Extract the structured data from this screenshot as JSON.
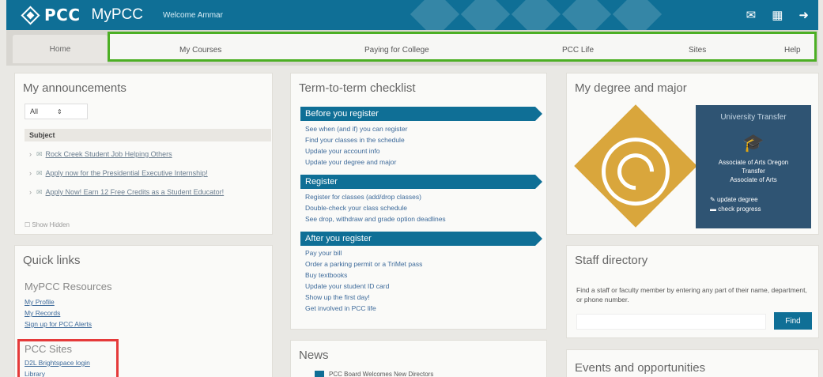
{
  "header": {
    "logo_text": "PCC",
    "app_name": "MyPCC",
    "welcome": "Welcome Ammar",
    "icons": [
      "mail-icon",
      "calendar-icon",
      "logout-icon"
    ]
  },
  "nav": {
    "home": "Home",
    "tabs": [
      "My Courses",
      "Paying for College",
      "PCC Life",
      "Sites",
      "Help"
    ]
  },
  "announcements": {
    "title": "My announcements",
    "filter_value": "All",
    "subject_header": "Subject",
    "items": [
      "Rock Creek Student Job Helping Others",
      "Apply now for the Presidential Executive Internship!",
      "Apply Now! Earn 12 Free Credits as a Student Educator!"
    ],
    "show_hidden": "Show Hidden"
  },
  "quick_links": {
    "title": "Quick links",
    "resources_title": "MyPCC Resources",
    "resources": [
      "My Profile",
      "My Records",
      "Sign up for PCC Alerts"
    ],
    "sites_title": "PCC Sites",
    "sites": [
      "D2L Brightspace login",
      "Library"
    ]
  },
  "checklist": {
    "title": "Term-to-term checklist",
    "sections": [
      {
        "heading": "Before you register",
        "items": [
          "See when (and if) you can register",
          "Find your classes in the schedule",
          "Update your account info",
          "Update your degree and major"
        ]
      },
      {
        "heading": "Register",
        "items": [
          "Register for classes (add/drop classes)",
          "Double-check your class schedule",
          "See drop, withdraw and grade option deadlines"
        ]
      },
      {
        "heading": "After you register",
        "items": [
          "Pay your bill",
          "Order a parking permit or a TriMet pass",
          "Buy textbooks",
          "Update your student ID card",
          "Show up the first day!",
          "Get involved in PCC life"
        ]
      }
    ]
  },
  "news": {
    "title": "News",
    "first_item": "PCC Board Welcomes New Directors"
  },
  "degree": {
    "title": "My degree and major",
    "card_title": "University Transfer",
    "degree_line1": "Associate of Arts Oregon",
    "degree_line2": "Transfer",
    "degree_line3": "Associate of Arts",
    "update_link": "update degree",
    "progress_link": "check progress"
  },
  "staff": {
    "title": "Staff directory",
    "description": "Find a staff or faculty member by entering any part of their name, department, or phone number.",
    "button": "Find"
  },
  "events": {
    "title": "Events and opportunities"
  }
}
